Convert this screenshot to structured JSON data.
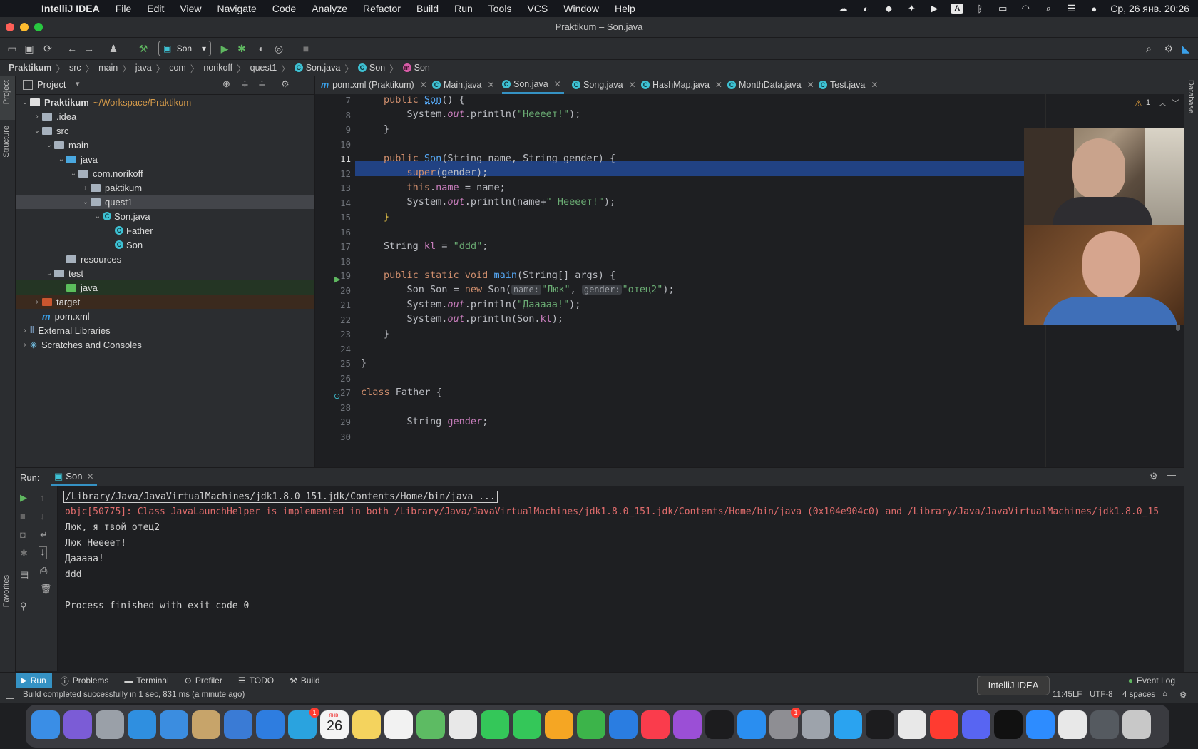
{
  "menubar": {
    "app_name": "IntelliJ IDEA",
    "items": [
      "File",
      "Edit",
      "View",
      "Navigate",
      "Code",
      "Analyze",
      "Refactor",
      "Build",
      "Run",
      "Tools",
      "VCS",
      "Window",
      "Help"
    ],
    "clock": "Ср, 26 янв.  20:26"
  },
  "window": {
    "title": "Praktikum – Son.java"
  },
  "toolbar": {
    "run_config": "Son"
  },
  "breadcrumb": [
    "Praktikum",
    "src",
    "main",
    "java",
    "com",
    "norikoff",
    "quest1",
    "Son.java",
    "Son",
    "Son"
  ],
  "project": {
    "header": "Project",
    "tree": [
      {
        "label": "Praktikum",
        "extra": "~/Workspace/Praktikum",
        "depth": 0,
        "open": true,
        "kind": "folder-white",
        "bold": true
      },
      {
        "label": ".idea",
        "depth": 1,
        "open": false,
        "kind": "folder"
      },
      {
        "label": "src",
        "depth": 1,
        "open": true,
        "kind": "folder"
      },
      {
        "label": "main",
        "depth": 2,
        "open": true,
        "kind": "folder"
      },
      {
        "label": "java",
        "depth": 3,
        "open": true,
        "kind": "folder-blue"
      },
      {
        "label": "com.norikoff",
        "depth": 4,
        "open": true,
        "kind": "folder"
      },
      {
        "label": "paktikum",
        "depth": 5,
        "open": false,
        "kind": "folder"
      },
      {
        "label": "quest1",
        "depth": 5,
        "open": true,
        "kind": "folder",
        "selected": true
      },
      {
        "label": "Son.java",
        "depth": 6,
        "open": true,
        "kind": "class"
      },
      {
        "label": "Father",
        "depth": 7,
        "kind": "class"
      },
      {
        "label": "Son",
        "depth": 7,
        "kind": "class"
      },
      {
        "label": "resources",
        "depth": 3,
        "kind": "folder"
      },
      {
        "label": "test",
        "depth": 2,
        "open": true,
        "kind": "folder"
      },
      {
        "label": "java",
        "depth": 3,
        "kind": "folder-green",
        "highlight": "green"
      },
      {
        "label": "target",
        "depth": 1,
        "open": false,
        "kind": "folder-red",
        "highlight": "orange"
      },
      {
        "label": "pom.xml",
        "depth": 1,
        "kind": "maven"
      },
      {
        "label": "External Libraries",
        "depth": 0,
        "open": false,
        "kind": "lib"
      },
      {
        "label": "Scratches and Consoles",
        "depth": 0,
        "open": false,
        "kind": "scratch"
      }
    ]
  },
  "tabs": [
    {
      "label": "pom.xml (Praktikum)",
      "icon": "m"
    },
    {
      "label": "Main.java",
      "icon": "c"
    },
    {
      "label": "Son.java",
      "icon": "c",
      "active": true
    },
    {
      "label": "Song.java",
      "icon": "c"
    },
    {
      "label": "HashMap.java",
      "icon": "c"
    },
    {
      "label": "MonthData.java",
      "icon": "c"
    },
    {
      "label": "Test.java",
      "icon": "c"
    }
  ],
  "editor": {
    "warnings": "1",
    "lines": [
      "7",
      "8",
      "9",
      "10",
      "11",
      "12",
      "13",
      "14",
      "15",
      "16",
      "17",
      "18",
      "19",
      "20",
      "21",
      "22",
      "23",
      "24",
      "25",
      "26",
      "27",
      "28",
      "29",
      "30"
    ],
    "code": {
      "l7a": "public ",
      "l7b": "Son",
      "l7c": "() {",
      "l8a": "    System.",
      "l8b": "out",
      "l8c": ".println(",
      "l8d": "\"Неееет!\"",
      "l8e": ");",
      "l9": "}",
      "l11a": "public ",
      "l11b": "Son",
      "l11c": "(String name, String gender) {",
      "l12a": "    ",
      "l12b": "super",
      "l12c": "(gender);",
      "l13a": "    ",
      "l13b": "this",
      "l13c": ".",
      "l13d": "name",
      "l13e": " = name;",
      "l14a": "    System.",
      "l14b": "out",
      "l14c": ".println(name+",
      "l14d": "\" Неееет!\"",
      "l14e": ");",
      "l15": "}",
      "l17a": "String ",
      "l17b": "kl",
      "l17c": " = ",
      "l17d": "\"ddd\"",
      "l17e": ";",
      "l19a": "public static void ",
      "l19b": "main",
      "l19c": "(String[] args) {",
      "l20a": "    Son Son = ",
      "l20b": "new ",
      "l20c": "Son(",
      "l20h1": "name:",
      "l20d": "\"Люк\"",
      "l20e": ", ",
      "l20h2": "gender:",
      "l20f": "\"отец2\"",
      "l20g": ");",
      "l21a": "    System.",
      "l21b": "out",
      "l21c": ".println(",
      "l21d": "\"Дааааа!\"",
      "l21e": ");",
      "l22a": "    System.",
      "l22b": "out",
      "l22c": ".println(Son.",
      "l22d": "kl",
      "l22e": ");",
      "l23": "}",
      "l25": "}",
      "l27a": "class ",
      "l27b": "Father {",
      "l29a": "    String ",
      "l29b": "gender",
      "l29c": ";"
    }
  },
  "run": {
    "label": "Run:",
    "tab": "Son",
    "console": [
      "/Library/Java/JavaVirtualMachines/jdk1.8.0_151.jdk/Contents/Home/bin/java ...",
      "objc[50775]: Class JavaLaunchHelper is implemented in both /Library/Java/JavaVirtualMachines/jdk1.8.0_151.jdk/Contents/Home/bin/java (0x104e904c0) and /Library/Java/JavaVirtualMachines/jdk1.8.0_15",
      "Люк, я твой отец2",
      "Люк Неееет!",
      "Дааааа!",
      "ddd",
      "",
      "Process finished with exit code 0"
    ]
  },
  "bottom_tabs": [
    "Run",
    "Problems",
    "Terminal",
    "Profiler",
    "TODO",
    "Build"
  ],
  "event_log": "Event Log",
  "status": {
    "message": "Build completed successfully in 1 sec, 831 ms (a minute ago)",
    "position": "11:45",
    "line_sep": "LF",
    "encoding": "UTF-8",
    "indent": "4 spaces"
  },
  "side_labels": {
    "project": "Project",
    "structure": "Structure",
    "favorites": "Favorites",
    "database": "Database"
  },
  "dock_tooltip": "IntelliJ IDEA",
  "dock_badges": {
    "telegram": "1",
    "calendar_day": "26",
    "calendar_month": "янв.",
    "settings": "1"
  },
  "colors": {
    "accent": "#3592c4",
    "selection": "#214283",
    "error": "#e06c6c"
  }
}
